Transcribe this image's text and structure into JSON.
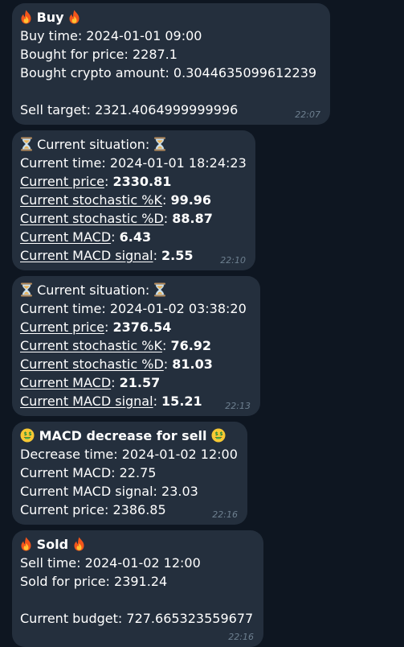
{
  "messages": [
    {
      "icon": "fire-icon",
      "title": "Buy",
      "lines": [
        {
          "label": "Buy time: ",
          "value": "2024-01-01 09:00"
        },
        {
          "label": "Bought for price: ",
          "value": "2287.1"
        },
        {
          "label": "Bought crypto amount: ",
          "value": "0.3044635099612239"
        },
        {
          "label": "",
          "value": ""
        },
        {
          "label": "Sell target: ",
          "value": "2321.4064999999996"
        }
      ],
      "time": "22:07"
    },
    {
      "icon": "hourglass-icon",
      "title": "Current situation:",
      "time_line": {
        "label": "Current time: ",
        "value": "2024-01-01 18:24:23"
      },
      "metrics": [
        {
          "label": "Current price",
          "value": "2330.81"
        },
        {
          "label": "Current stochastic %K",
          "value": "99.96"
        },
        {
          "label": "Current stochastic %D",
          "value": "88.87"
        },
        {
          "label": "Current MACD",
          "value": "6.43"
        },
        {
          "label": "Current MACD signal",
          "value": "2.55"
        }
      ],
      "time": "22:10"
    },
    {
      "icon": "hourglass-icon",
      "title": "Current situation:",
      "time_line": {
        "label": "Current time: ",
        "value": "2024-01-02 03:38:20"
      },
      "metrics": [
        {
          "label": "Current price",
          "value": "2376.54"
        },
        {
          "label": "Current stochastic %K",
          "value": "76.92"
        },
        {
          "label": "Current stochastic %D",
          "value": "81.03"
        },
        {
          "label": "Current MACD",
          "value": "21.57"
        },
        {
          "label": "Current MACD signal",
          "value": "15.21"
        }
      ],
      "time": "22:13"
    },
    {
      "icon": "money-mouth-face-icon",
      "title": "MACD decrease for sell",
      "lines": [
        {
          "label": "Decrease time: ",
          "value": "2024-01-02 12:00"
        },
        {
          "label": "Current MACD: ",
          "value": "22.75"
        },
        {
          "label": "Current MACD signal: ",
          "value": "23.03"
        },
        {
          "label": "Current price: ",
          "value": "2386.85"
        }
      ],
      "time": "22:16"
    },
    {
      "icon": "fire-icon",
      "title": "Sold",
      "lines": [
        {
          "label": "Sell time: ",
          "value": "2024-01-02 12:00"
        },
        {
          "label": "Sold for price: ",
          "value": "2391.24"
        },
        {
          "label": "",
          "value": ""
        },
        {
          "label": "Current budget: ",
          "value": "727.665323559677"
        }
      ],
      "time": "22:16"
    }
  ],
  "colors": {
    "background": "#0e1621",
    "bubble": "#242f3d",
    "timestamp": "#6d7f8f"
  }
}
